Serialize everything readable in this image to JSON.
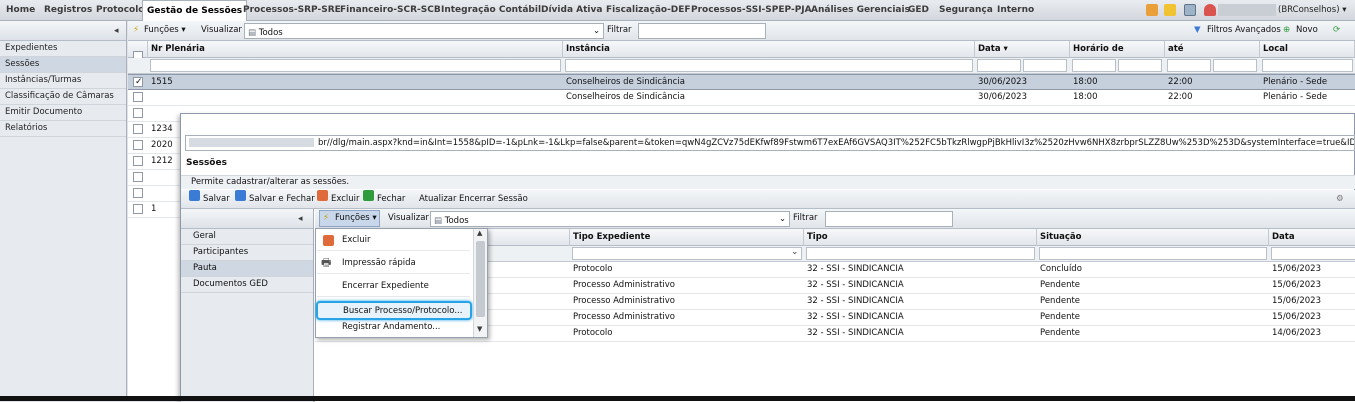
{
  "nav": {
    "items": [
      "Home",
      "Registros",
      "Protocolo",
      "Gestão de Sessões",
      "Processos-SRP-SRE",
      "Financeiro-SCR-SCB",
      "Integração Contábil",
      "Dívida Ativa",
      "Fiscalização-DEF",
      "Processos-SSI-SPEP-PJA",
      "Análises Gerenciais",
      "GED",
      "Segurança",
      "Interno"
    ],
    "active": "Gestão de Sessões",
    "user_suffix": "(BRConselhos)",
    "user_caret": "▾"
  },
  "sidebar": {
    "collapse_glyph": "◂",
    "items": [
      "Expedientes",
      "Sessões",
      "Instâncias/Turmas",
      "Classificação de Câmaras",
      "Emitir Documento",
      "Relatórios"
    ],
    "selected": "Sessões"
  },
  "main": {
    "toolbar": {
      "funcoes": "Funções ▾",
      "visualizar": "Visualizar",
      "view_value": "Todos",
      "filtrar": "Filtrar",
      "filtros_avancados": "Filtros Avançados",
      "novo": "Novo"
    },
    "columns": [
      "Nr Plenária",
      "Instância",
      "Data ▾",
      "Horário de",
      "até",
      "Local"
    ],
    "rows": [
      {
        "nr": "1515",
        "inst": "Conselheiros de Sindicância",
        "data": "30/06/2023",
        "de": "18:00",
        "ate": "22:00",
        "local": "Plenário - Sede",
        "checked": true
      },
      {
        "nr": "",
        "inst": "Conselheiros de Sindicância",
        "data": "30/06/2023",
        "de": "18:00",
        "ate": "22:00",
        "local": "Plenário - Sede",
        "checked": false
      },
      {
        "nr": "",
        "inst": "",
        "data": "",
        "de": "",
        "ate": "",
        "local": "",
        "checked": false
      },
      {
        "nr": "1234",
        "inst": "",
        "data": "",
        "de": "",
        "ate": "",
        "local": "",
        "checked": false
      },
      {
        "nr": "2020",
        "inst": "",
        "data": "",
        "de": "",
        "ate": "",
        "local": "",
        "checked": false
      },
      {
        "nr": "1212",
        "inst": "",
        "data": "",
        "de": "",
        "ate": "",
        "local": "",
        "checked": false
      },
      {
        "nr": "",
        "inst": "",
        "data": "",
        "de": "",
        "ate": "",
        "local": "",
        "checked": false
      },
      {
        "nr": "",
        "inst": "",
        "data": "",
        "de": "",
        "ate": "",
        "local": "",
        "checked": false
      },
      {
        "nr": "1",
        "inst": "",
        "data": "",
        "de": "",
        "ate": "",
        "local": "",
        "checked": false
      }
    ]
  },
  "popup": {
    "url": "br//dlg/main.aspx?knd=in&Int=1558&pID=-1&pLnk=-1&Lkp=false&parent=&token=qwN4gZCVz75dEKfwf89Fstwm6T7exEAf6GVSAQ3IT%252FC5bTkzRlwgpPjBkHlivI3z%2520zHvw6NHX8zrbprSLZZ8Uw%253D%253D&systemInterface=true&ID=4263",
    "title": "Sessões",
    "description": "Permite cadastrar/alterar as sessões.",
    "toolbar": [
      "Salvar",
      "Salvar e Fechar",
      "Excluir",
      "Fechar",
      "Atualizar",
      "Encerrar Sessão"
    ],
    "left_items": [
      "Geral",
      "Participantes",
      "Pauta",
      "Documentos GED"
    ],
    "left_selected": "Pauta",
    "inner_toolbar": {
      "funcoes": "Funções ▾",
      "visualizar": "Visualizar",
      "view_value": "Todos",
      "filtrar": "Filtrar"
    },
    "columns": [
      "Tipo Expediente",
      "Tipo",
      "Situação",
      "Data"
    ],
    "rows": [
      {
        "tipo_exp": "Protocolo",
        "tipo": "32 - SSI - SINDICANCIA",
        "situacao": "Concluído",
        "data": "15/06/2023"
      },
      {
        "tipo_exp": "Processo Administrativo",
        "tipo": "32 - SSI - SINDICANCIA",
        "situacao": "Pendente",
        "data": "15/06/2023"
      },
      {
        "tipo_exp": "Processo Administrativo",
        "tipo": "32 - SSI - SINDICANCIA",
        "situacao": "Pendente",
        "data": "15/06/2023"
      },
      {
        "tipo_exp": "Processo Administrativo",
        "tipo": "32 - SSI - SINDICANCIA",
        "situacao": "Pendente",
        "data": "15/06/2023"
      },
      {
        "tipo_exp": "Protocolo",
        "tipo": "32 - SSI - SINDICANCIA",
        "situacao": "Pendente",
        "data": "14/06/2023"
      }
    ]
  },
  "menu": {
    "items": [
      "Excluir",
      "Impressão rápida",
      "Encerrar Expediente",
      "Buscar Processo/Protocolo...",
      "Registrar Andamento..."
    ],
    "highlighted": "Buscar Processo/Protocolo..."
  }
}
